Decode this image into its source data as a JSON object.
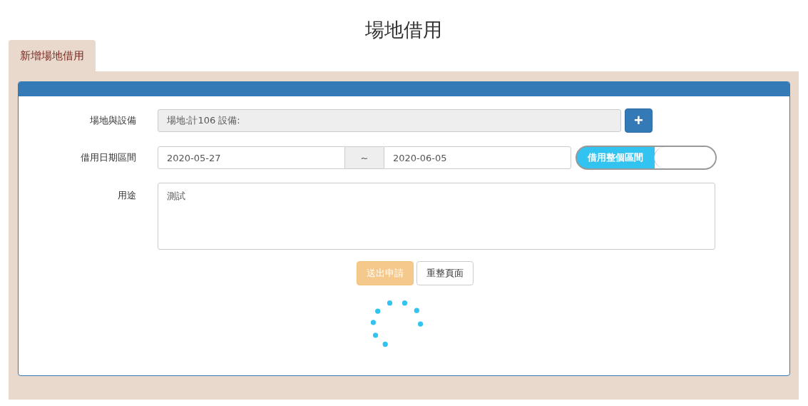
{
  "page_title": "場地借用",
  "tabs": [
    {
      "label": "新增場地借用",
      "selected": true
    }
  ],
  "form": {
    "venue": {
      "label": "場地與設備",
      "value": "場地:計106  設備:",
      "add_button": "+"
    },
    "date_range": {
      "label": "借用日期區間",
      "start": "2020-05-27",
      "separator": "~",
      "end": "2020-06-05",
      "toggle": {
        "label": "借用整個區間",
        "on": true
      }
    },
    "purpose": {
      "label": "用途",
      "value": "測試"
    },
    "buttons": [
      {
        "label": "送出申請",
        "kind": "primary",
        "disabled": true
      },
      {
        "label": "重整頁面",
        "kind": "default",
        "disabled": false
      }
    ],
    "loading": true
  }
}
